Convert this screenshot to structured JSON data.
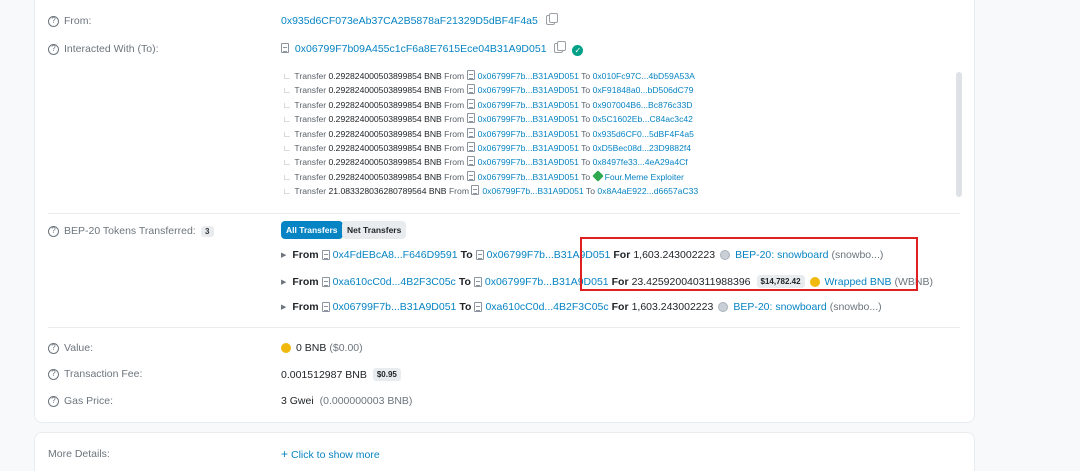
{
  "from": {
    "label": "From:",
    "address": "0x935d6CF073eAb37CA2B5878aF21329D5dBF4F4a5"
  },
  "interacted": {
    "label": "Interacted With (To):",
    "address": "0x06799F7b09A455c1cF6a8E7615Ece04B31A9D051",
    "internal_transfers": [
      {
        "word": "Transfer",
        "amount": "0.292824000503899854 BNB",
        "from_word": "From",
        "from": "0x06799F7b...B31A9D051",
        "to_word": "To",
        "to": "0x010Fc97C...4bD59A53A"
      },
      {
        "word": "Transfer",
        "amount": "0.292824000503899854 BNB",
        "from_word": "From",
        "from": "0x06799F7b...B31A9D051",
        "to_word": "To",
        "to": "0xF91848a0...bD506dC79"
      },
      {
        "word": "Transfer",
        "amount": "0.292824000503899854 BNB",
        "from_word": "From",
        "from": "0x06799F7b...B31A9D051",
        "to_word": "To",
        "to": "0x907004B6...Bc876c33D"
      },
      {
        "word": "Transfer",
        "amount": "0.292824000503899854 BNB",
        "from_word": "From",
        "from": "0x06799F7b...B31A9D051",
        "to_word": "To",
        "to": "0x5C1602Eb...C84ac3c42"
      },
      {
        "word": "Transfer",
        "amount": "0.292824000503899854 BNB",
        "from_word": "From",
        "from": "0x06799F7b...B31A9D051",
        "to_word": "To",
        "to": "0x935d6CF0...5dBF4F4a5"
      },
      {
        "word": "Transfer",
        "amount": "0.292824000503899854 BNB",
        "from_word": "From",
        "from": "0x06799F7b...B31A9D051",
        "to_word": "To",
        "to": "0xD5Bec08d...23D9882f4"
      },
      {
        "word": "Transfer",
        "amount": "0.292824000503899854 BNB",
        "from_word": "From",
        "from": "0x06799F7b...B31A9D051",
        "to_word": "To",
        "to": "0x8497fe33...4eA29a4Cf"
      },
      {
        "word": "Transfer",
        "amount": "0.292824000503899854 BNB",
        "from_word": "From",
        "from": "0x06799F7b...B31A9D051",
        "to_word": "To",
        "to": "Four.Meme Exploiter"
      },
      {
        "word": "Transfer",
        "amount": "21.083328036280789564 BNB",
        "from_word": "From",
        "from": "0x06799F7b...B31A9D051",
        "to_word": "To",
        "to": "0x8A4aE922...d6657aC33"
      }
    ]
  },
  "tokens": {
    "label": "BEP-20 Tokens Transferred:",
    "count": "3",
    "tab_all": "All Transfers",
    "tab_net": "Net Transfers",
    "rows": [
      {
        "from_word": "From",
        "from": "0x4FdEBcA8...F646D9591",
        "to_word": "To",
        "to": "0x06799F7b...B31A9D051",
        "for_word": "For",
        "amount": "1,603.243002223",
        "price": "",
        "token": "BEP-20: snowboard",
        "symbol": "(snowbo...)"
      },
      {
        "from_word": "From",
        "from": "0xa610cC0d...4B2F3C05c",
        "to_word": "To",
        "to": "0x06799F7b...B31A9D051",
        "for_word": "For",
        "amount": "23.425920040311988396",
        "price": "$14,782.42",
        "token": "Wrapped BNB",
        "symbol": "(WBNB)"
      },
      {
        "from_word": "From",
        "from": "0x06799F7b...B31A9D051",
        "to_word": "To",
        "to": "0xa610cC0d...4B2F3C05c",
        "for_word": "For",
        "amount": "1,603.243002223",
        "price": "",
        "token": "BEP-20: snowboard",
        "symbol": "(snowbo...)"
      }
    ]
  },
  "value": {
    "label": "Value:",
    "amount": "0 BNB",
    "usd": "($0.00)"
  },
  "fee": {
    "label": "Transaction Fee:",
    "amount": "0.001512987 BNB",
    "usd": "$0.95"
  },
  "gas": {
    "label": "Gas Price:",
    "amount": "3 Gwei",
    "detail": "(0.000000003 BNB)"
  },
  "more": {
    "label": "More Details:",
    "link": "Click to show more"
  },
  "colors": {
    "link": "#0784c3",
    "highlight": "#e02020",
    "bnb": "#f0b90b",
    "verified": "#00a186"
  }
}
